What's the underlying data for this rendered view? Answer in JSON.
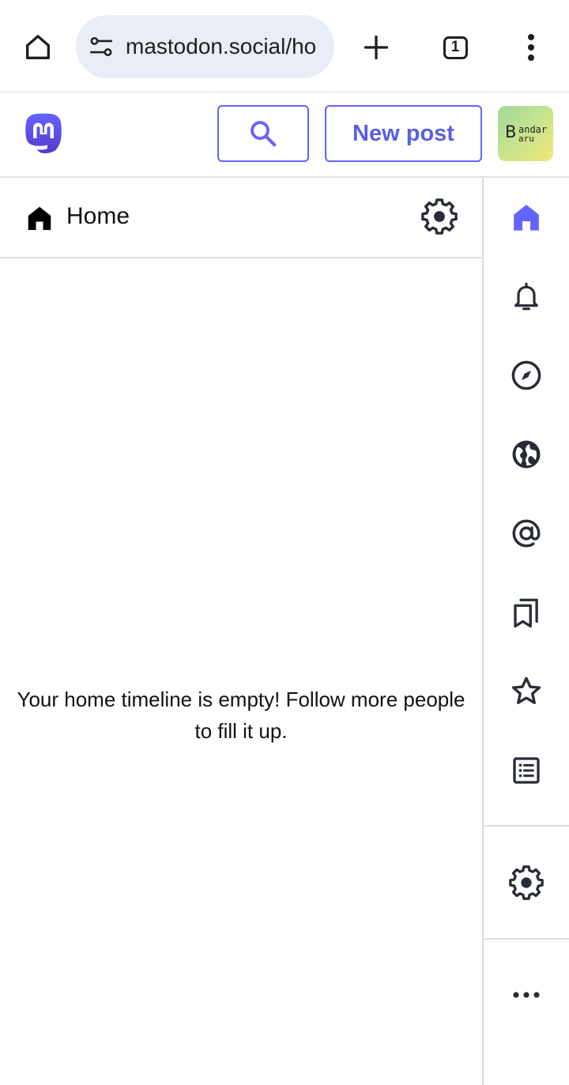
{
  "browser": {
    "url": "mastodon.social/ho",
    "tab_count": "1",
    "icons": {
      "home": "home-outline-icon",
      "site_settings": "tune-icon",
      "new_tab": "plus-icon",
      "tabs": "tabs-counter-icon",
      "menu": "more-vert-icon"
    }
  },
  "header": {
    "logo": "mastodon-logo-icon",
    "search_icon": "search-icon",
    "new_post_label": "New post",
    "avatar": {
      "initial": "B",
      "line1": "andar",
      "line2": "aru"
    }
  },
  "column": {
    "title": "Home",
    "icon": "home-icon",
    "settings_icon": "gear-icon",
    "empty_message": "Your home timeline is empty! Follow more people to fill it up."
  },
  "nav": {
    "items": [
      {
        "icon": "home-icon",
        "active": true
      },
      {
        "icon": "bell-icon",
        "active": false
      },
      {
        "icon": "compass-icon",
        "active": false
      },
      {
        "icon": "globe-icon",
        "active": false
      },
      {
        "icon": "at-icon",
        "active": false
      },
      {
        "icon": "bookmarks-icon",
        "active": false
      },
      {
        "icon": "star-icon",
        "active": false
      },
      {
        "icon": "list-icon",
        "active": false
      },
      {
        "icon": "gear-icon",
        "active": false
      },
      {
        "icon": "more-horizontal-icon",
        "active": false
      }
    ]
  },
  "colors": {
    "accent": "#6364ff",
    "accent_text": "#5b5fe0",
    "icon": "#282c37",
    "url_pill_bg": "#e8edf6",
    "divider": "#dcdce2"
  }
}
